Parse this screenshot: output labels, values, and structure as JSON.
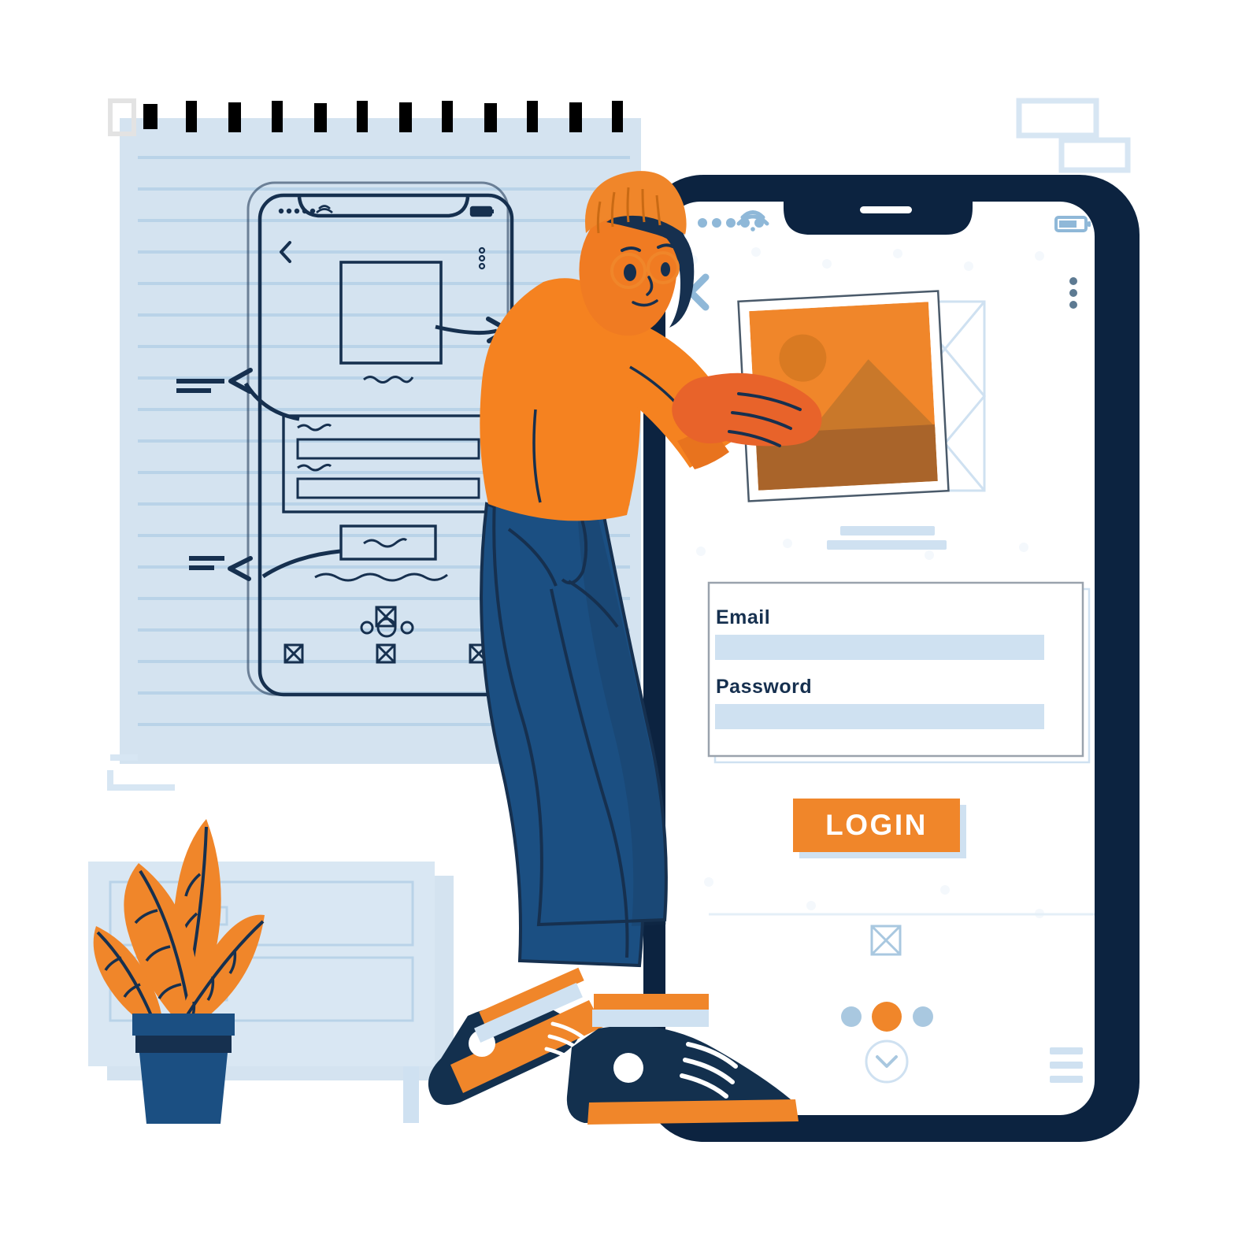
{
  "scene": {
    "title": "Mobile app login screen design illustration",
    "background_color": "#ffffff"
  },
  "palette": {
    "orange": "#F0862A",
    "orange_dark": "#E8632A",
    "orange_deep": "#C06A1E",
    "navy": "#0C2340",
    "navy_ink": "#16304f",
    "blue_jeans": "#1B4F82",
    "paper_blue": "#D4E3F0",
    "rule_blue": "#B9D3E8",
    "field_blue": "#CFE1F1",
    "placeholder_blue": "#A9C8E0",
    "white": "#ffffff",
    "grey_line": "#9AA3AD"
  },
  "notepad": {
    "name": "lined-notepad-sketch",
    "spiral_hole_count": 14,
    "sketch": {
      "title": "hand-drawn mobile wireframe",
      "status_bar_dots": 5,
      "has_wifi_icon": true,
      "has_battery_icon": true,
      "has_back_chevron": true,
      "has_kebab_menu": true,
      "image_box": true,
      "squiggle_lines": 4,
      "form_fields": 2,
      "button_box": true,
      "bottom_dots": 3,
      "bottom_nav_icons": 3,
      "annotation_arrows": 3,
      "annotation_marks": 3
    }
  },
  "phone": {
    "name": "phone-mockup",
    "frame_color": "#0C2340",
    "status_bar": {
      "signal_dots": 5,
      "wifi_label": "wifi-icon",
      "battery_label": "battery-icon"
    },
    "header": {
      "back_label": "back-chevron-icon",
      "menu_label": "kebab-menu-icon"
    },
    "content": {
      "image_card_label": "photo-placeholder",
      "image_card_alt": "orange landscape with sun and mountain",
      "text_bars": 2
    },
    "form": {
      "name": "login-form",
      "email_label": "Email",
      "email_value": "",
      "email_placeholder": "",
      "password_label": "Password",
      "password_value": "",
      "password_placeholder": ""
    },
    "login_button": {
      "label": "LOGIN",
      "background": "#F0862A",
      "text_color": "#ffffff"
    },
    "footer": {
      "image_icon_label": "image-placeholder-icon",
      "pagination": {
        "total": 3,
        "active_index": 1,
        "active_color": "#F0862A",
        "inactive_color": "#A9C8E0"
      },
      "chevron_down_label": "chevron-down-circle-icon",
      "hamburger_label": "hamburger-menu-icon",
      "hamburger_bars": 3
    }
  },
  "character": {
    "name": "designer-person",
    "beanie_color": "#F0862A",
    "hair_color": "#16304f",
    "skin_color": "#F07B22",
    "glasses_color": "#F0862A",
    "sweater_color": "#F58220",
    "jeans_color": "#1B4F82",
    "shoe_color": "#13304E",
    "shoe_sole_color": "#F0862A",
    "sock_color": "#CFE1F1"
  },
  "plant": {
    "name": "potted-plant",
    "leaf_count": 4,
    "leaf_color": "#F0862A",
    "pot_color": "#1B4F82",
    "pot_rim_color": "#16304f"
  },
  "backdrop_card": {
    "name": "wireframe-card-backdrop",
    "fill": "#D4E3F0",
    "rows": 3,
    "chips": 2,
    "legs": 1
  },
  "decor": {
    "top_right_rect_count": 2,
    "corner_bracket_count": 2,
    "color": "#D7E6F3"
  }
}
